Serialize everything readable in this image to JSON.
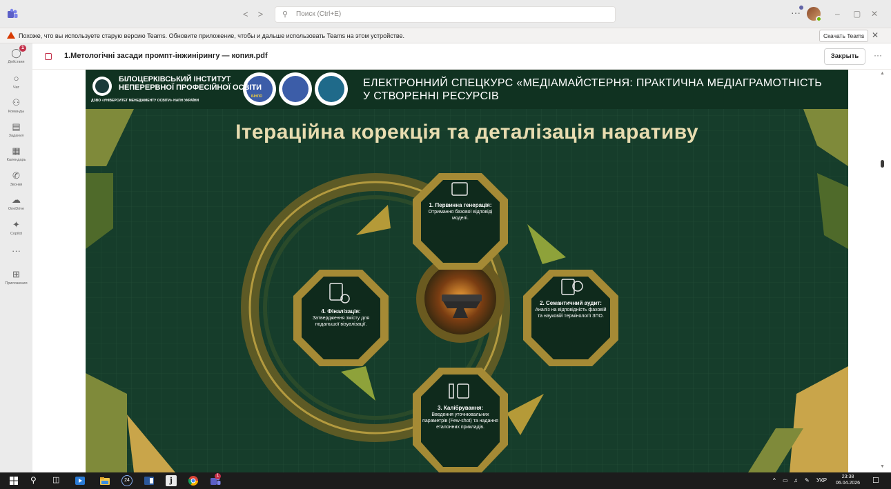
{
  "titlebar": {
    "search_placeholder": "Поиск (Ctrl+E)",
    "back": "<",
    "forward": ">",
    "more": "···",
    "minimize": "–",
    "restore": "▢",
    "close": "✕"
  },
  "warning": {
    "text": "Похоже, что вы используете старую версию Teams. Обновите приложение, чтобы и дальше использовать Teams на этом устройстве.",
    "download_label": "Скачать Teams",
    "close": "✕"
  },
  "rail": {
    "items": [
      {
        "label": "Действия",
        "icon": "bell-icon",
        "badge": "1"
      },
      {
        "label": "Чат",
        "icon": "chat-icon"
      },
      {
        "label": "Команды",
        "icon": "teams-icon"
      },
      {
        "label": "Задания",
        "icon": "assignments-icon"
      },
      {
        "label": "Календарь",
        "icon": "calendar-icon"
      },
      {
        "label": "Звонки",
        "icon": "calls-icon"
      },
      {
        "label": "OneDrive",
        "icon": "onedrive-icon"
      },
      {
        "label": "Copilot",
        "icon": "copilot-icon"
      },
      {
        "label": "···",
        "icon": "more-apps-icon"
      },
      {
        "label": "Приложения",
        "icon": "apps-icon"
      }
    ]
  },
  "document": {
    "title": "1.Метологічні засади промпт-інжинірингу — копия.pdf",
    "close_label": "Закрыть",
    "more": "···"
  },
  "slide": {
    "org_name_line1": "БІЛОЦЕРКІВСЬКИЙ ІНСТИТУТ",
    "org_name_line2": "НЕПЕРЕРВНОЇ ПРОФЕСІЙНОЇ ОСВІТИ",
    "org_sub": "ДЗВО «УНІВЕРСИТЕТ МЕНЕДЖМЕНТУ ОСВІТИ» НАПН УКРАЇНИ",
    "logo_badge_text": "БІНПО",
    "course_title": "ЕЛЕКТРОННИЙ СПЕЦКУРС «МЕДІАМАЙСТЕРНЯ: ПРАКТИЧНА МЕДІАГРАМОТНІСТЬ У СТВОРЕННІ РЕСУРСІВ",
    "heading": "Ітераційна корекція та деталізація наративу",
    "steps": [
      {
        "head": "1. Первинна генерація:",
        "body": "Отримання базової відповіді моделі."
      },
      {
        "head": "2. Семантичний аудит:",
        "body": "Аналіз на відповідність фаховій та науковій термінології ЗПО."
      },
      {
        "head": "3. Калібрування:",
        "body": "Введення уточнювальних параметрів (Few-shot) та надання еталонних прикладів."
      },
      {
        "head": "4. Фіналізація:",
        "body": "Затвердження змісту для подальшої візуалізації."
      }
    ]
  },
  "taskbar": {
    "badge_count": "24",
    "notepad_letter": "j",
    "teams_badge": "1",
    "tray_up": "^",
    "language": "УКР",
    "time": "23:38",
    "date": "06.04.2026"
  },
  "colors": {
    "accent": "#6264a7",
    "warning": "#d83b01",
    "slide_bg": "#173f2c",
    "gold": "#c9a54a"
  }
}
